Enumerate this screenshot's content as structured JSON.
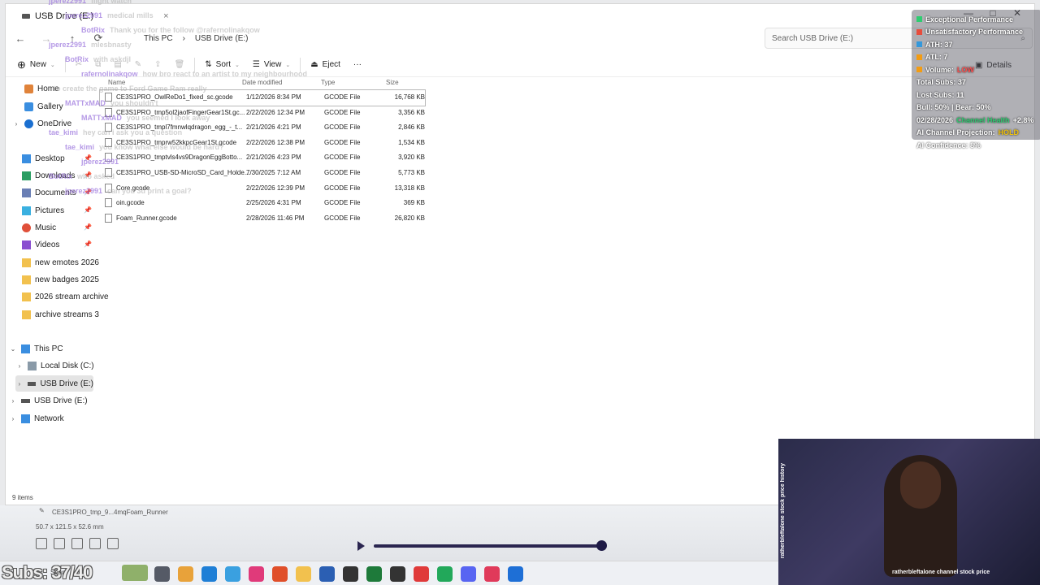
{
  "window": {
    "tab_title": "USB Drive (E:)",
    "close_glyph": "×",
    "min_glyph": "—",
    "max_glyph": "□",
    "xclose_glyph": "✕"
  },
  "address": {
    "back": "←",
    "forward": "→",
    "up": "↑",
    "refresh": "⟳",
    "breadcrumb": [
      "This PC",
      "USB Drive (E:)"
    ],
    "search_placeholder": "Search USB Drive (E:)"
  },
  "toolbar": {
    "new_label": "New",
    "sort_label": "Sort",
    "view_label": "View",
    "eject_label": "Eject",
    "more_label": "···",
    "details_label": "Details"
  },
  "sidebar": {
    "quick": [
      {
        "label": "Home",
        "icon": "home-icon",
        "color": "#e0833a"
      },
      {
        "label": "Gallery",
        "icon": "gallery-icon",
        "color": "#3a8ee0"
      },
      {
        "label": "OneDrive",
        "icon": "cloud-icon",
        "color": "#1a6fd0"
      }
    ],
    "pinned": [
      {
        "label": "Desktop",
        "color": "#3a8ee0"
      },
      {
        "label": "Downloads",
        "color": "#2b9e63"
      },
      {
        "label": "Documents",
        "color": "#6a7fb5"
      },
      {
        "label": "Pictures",
        "color": "#3ab0e0"
      },
      {
        "label": "Music",
        "color": "#e0503a"
      },
      {
        "label": "Videos",
        "color": "#8a4fd0"
      },
      {
        "label": "new emotes 2026",
        "color": "#f2c14e"
      },
      {
        "label": "new badges 2025",
        "color": "#f2c14e"
      },
      {
        "label": "2026 stream archive",
        "color": "#f2c14e"
      },
      {
        "label": "archive streams 3",
        "color": "#f2c14e"
      }
    ],
    "this_pc": "This PC",
    "local_disk": "Local Disk (C:)",
    "usb_selected": "USB Drive (E:)",
    "usb_root": "USB Drive (E:)",
    "network": "Network"
  },
  "files": {
    "headers": {
      "name": "Name",
      "date": "Date modified",
      "type": "Type",
      "size": "Size"
    },
    "rows": [
      {
        "name": "CE3S1PRO_OwlReDo1_fixed_sc.gcode",
        "date": "1/12/2026 8:34 PM",
        "type": "GCODE File",
        "size": "16,768 KB"
      },
      {
        "name": "CE3S1PRO_tmp5ol2jaofFingerGear1St.gc...",
        "date": "2/22/2026 12:34 PM",
        "type": "GCODE File",
        "size": "3,356 KB"
      },
      {
        "name": "CE3S1PRO_tmpl7fmnwlqdragon_egg_-_t...",
        "date": "2/21/2026 4:21 PM",
        "type": "GCODE File",
        "size": "2,846 KB"
      },
      {
        "name": "CE3S1PRO_tmprw52kkpcGear1St.gcode",
        "date": "2/22/2026 12:38 PM",
        "type": "GCODE File",
        "size": "1,534 KB"
      },
      {
        "name": "CE3S1PRO_tmptvls4vs9DragonEggBotto...",
        "date": "2/21/2026 4:23 PM",
        "type": "GCODE File",
        "size": "3,920 KB"
      },
      {
        "name": "CE3S1PRO_USB-SD-MicroSD_Card_Holde...",
        "date": "7/30/2025 7:12 AM",
        "type": "GCODE File",
        "size": "5,773 KB"
      },
      {
        "name": "Core.gcode",
        "date": "2/22/2026 12:39 PM",
        "type": "GCODE File",
        "size": "13,318 KB"
      },
      {
        "name": "oin.gcode",
        "date": "2/25/2026 4:31 PM",
        "type": "GCODE File",
        "size": "369 KB"
      },
      {
        "name": "Foam_Runner.gcode",
        "date": "2/28/2026 11:46 PM",
        "type": "GCODE File",
        "size": "26,820 KB"
      }
    ],
    "status": "9 items"
  },
  "overlay": {
    "lines": [
      {
        "text": "Exceptional Performance",
        "color": "#2ecc71"
      },
      {
        "text": "Unsatisfactory Performance",
        "color": "#e74c3c"
      },
      {
        "text": "ATH: 37",
        "color": "#3498db"
      },
      {
        "text": "ATL: 7",
        "color": "#f39c12"
      }
    ],
    "volume_label": "Volume:",
    "volume_value": "LOW",
    "total_subs": "Total Subs: 37",
    "lost_subs": "Lost Subs: 11",
    "bull_bear": "Bull: 50% | Bear: 50%",
    "date": "02/28/2026",
    "channel_health": "Channel Health",
    "health_delta": "+2.8%",
    "projection_label": "AI Channel Projection:",
    "projection_value": "HOLD",
    "confidence": "AI Confidence: 8%"
  },
  "chat": [
    {
      "user": "jperez2991",
      "msg": "flight watch"
    },
    {
      "user": "jperez2991",
      "msg": "medical mills"
    },
    {
      "user": "BotRix",
      "msg": "Thank you for the follow @rafernolinakqow"
    },
    {
      "user": "jperez2991",
      "msg": "mlesbnasty"
    },
    {
      "user": "BotRix",
      "msg": "with askdjl"
    },
    {
      "user": "rafernolinakqow",
      "msg": "how bro react to an artist to my neighbourhood"
    },
    {
      "user": "",
      "msg": "to create the game to Ford Game Ram really"
    },
    {
      "user": "MATTxMAD",
      "msg": "you shouldn't"
    },
    {
      "user": "MATTxMAD",
      "msg": "you seemed l look away"
    },
    {
      "user": "tae_kimi",
      "msg": "hey can i ask you a question"
    },
    {
      "user": "tae_kimi",
      "msg": "you know what else would be hard?"
    },
    {
      "user": "jperez2991",
      "msg": ""
    },
    {
      "user": "BotRix",
      "msg": "who asked"
    },
    {
      "user": "jperez2991",
      "msg": "can you 3d print a goal?"
    }
  ],
  "slicer": {
    "file_label": "CE3S1PRO_tmp_9...4mqFoam_Runner",
    "dims": "50.7 x 121.5 x 52.6 mm"
  },
  "webcam": {
    "caption": "ratherbleftalone channel stock price",
    "vertical": "ratherbleftalone stock price history"
  },
  "taskbar": {
    "subs_counter": "Subs: 37/40",
    "search_label": "Sear",
    "icon_colors": [
      "#555a66",
      "#e8a23a",
      "#1f7fd6",
      "#3aa0e0",
      "#e03a7a",
      "#e04f2a",
      "#f2c14e",
      "#2b5fb3",
      "#333",
      "#1e7a3a",
      "#333",
      "#e03a3a",
      "#22a85a",
      "#5865f2",
      "#e03a5a",
      "#1e6fd6"
    ]
  }
}
